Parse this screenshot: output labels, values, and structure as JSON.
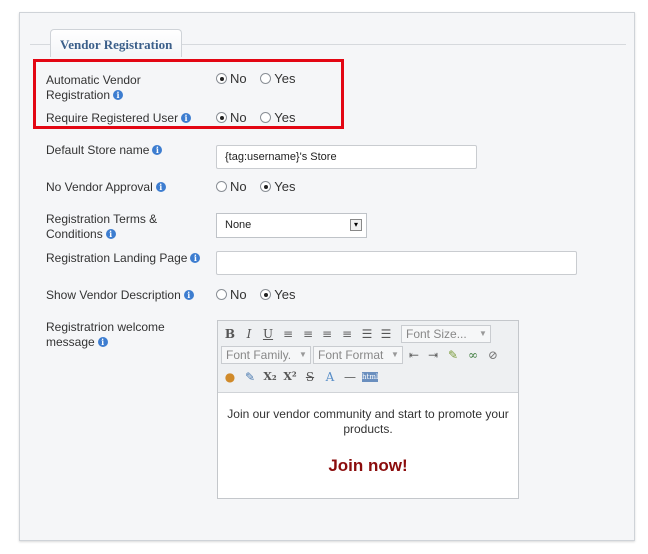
{
  "section": {
    "title": "Vendor Registration"
  },
  "colors": {
    "highlight": "#e30613",
    "legend_text": "#3b5f8a",
    "join_text": "#8b0c0c",
    "info_icon": "#3d7dd0"
  },
  "fields": {
    "automatic_vendor_registration": {
      "label_line1": "Automatic Vendor",
      "label_line2": "Registration",
      "options": [
        "No",
        "Yes"
      ],
      "selected": "No"
    },
    "require_registered_user": {
      "label": "Require Registered User",
      "options": [
        "No",
        "Yes"
      ],
      "selected": "No"
    },
    "default_store_name": {
      "label": "Default Store name",
      "value": "{tag:username}'s Store"
    },
    "no_vendor_approval": {
      "label": "No Vendor Approval",
      "options": [
        "No",
        "Yes"
      ],
      "selected": "Yes"
    },
    "registration_terms": {
      "label_line1": "Registration Terms &",
      "label_line2": "Conditions",
      "selected": "None"
    },
    "registration_landing_page": {
      "label": "Registration Landing Page",
      "value": ""
    },
    "show_vendor_description": {
      "label": "Show Vendor Description",
      "options": [
        "No",
        "Yes"
      ],
      "selected": "Yes"
    },
    "welcome_message": {
      "label_line1": "Registratrion welcome",
      "label_line2": "message",
      "toolbar": {
        "font_size": "Font Size...",
        "font_family": "Font Family.",
        "font_format": "Font Format"
      },
      "content_line1": "Join our vendor community and start to promote your",
      "content_line2": "products.",
      "content_cta": "Join now!"
    }
  }
}
